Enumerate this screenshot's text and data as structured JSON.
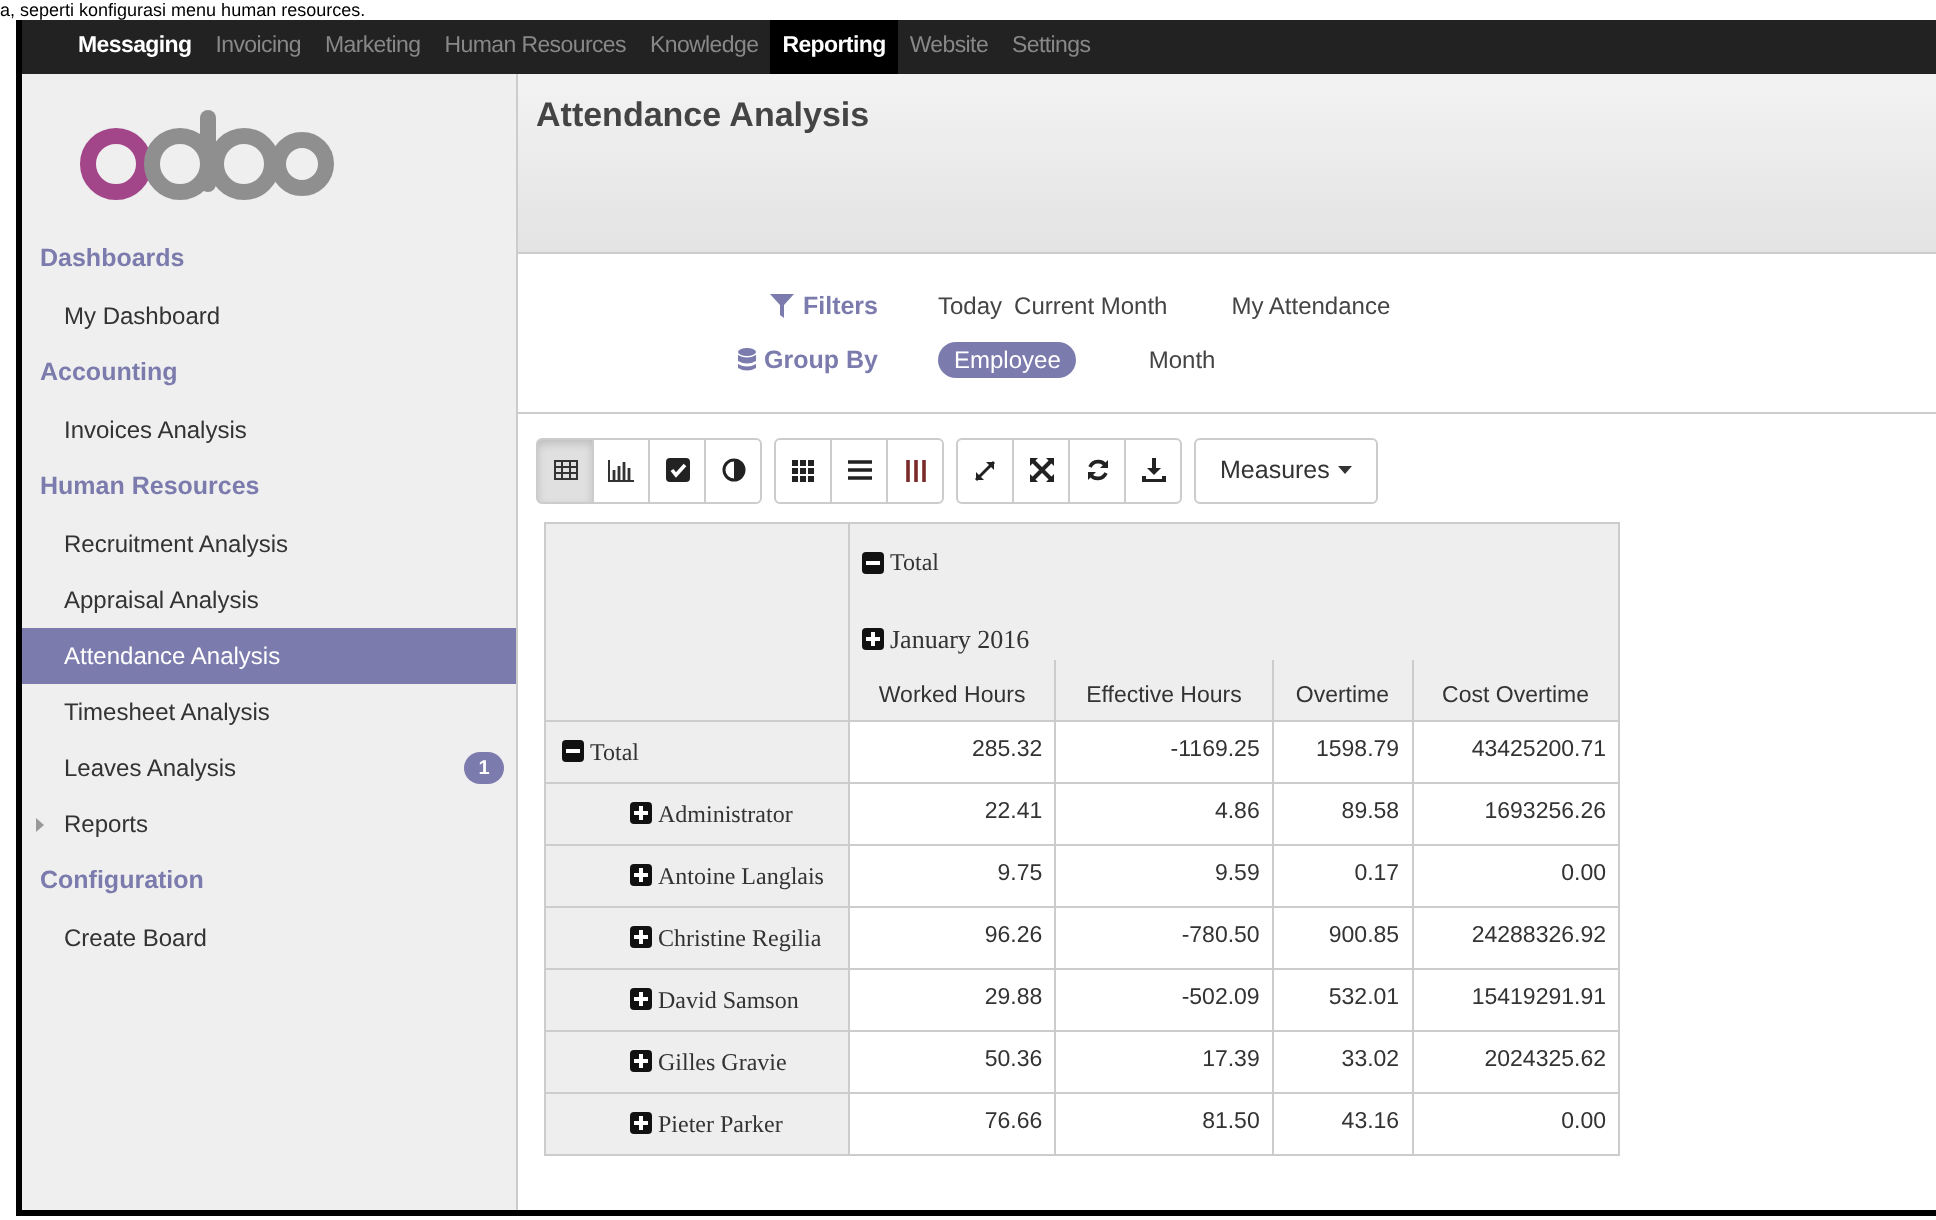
{
  "caption": "a, seperti konfigurasi menu human resources.",
  "navbar": {
    "items": [
      {
        "label": "Messaging",
        "bold": true,
        "selected": false
      },
      {
        "label": "Invoicing",
        "bold": false,
        "selected": false
      },
      {
        "label": "Marketing",
        "bold": false,
        "selected": false
      },
      {
        "label": "Human Resources",
        "bold": false,
        "selected": false
      },
      {
        "label": "Knowledge",
        "bold": false,
        "selected": false
      },
      {
        "label": "Reporting",
        "bold": true,
        "selected": true
      },
      {
        "label": "Website",
        "bold": false,
        "selected": false
      },
      {
        "label": "Settings",
        "bold": false,
        "selected": false
      }
    ]
  },
  "sidebar": {
    "sections": [
      {
        "title": "Dashboards",
        "items": [
          {
            "label": "My Dashboard",
            "selected": false
          }
        ]
      },
      {
        "title": "Accounting",
        "items": [
          {
            "label": "Invoices Analysis",
            "selected": false
          }
        ]
      },
      {
        "title": "Human Resources",
        "items": [
          {
            "label": "Recruitment Analysis",
            "selected": false
          },
          {
            "label": "Appraisal Analysis",
            "selected": false
          },
          {
            "label": "Attendance Analysis",
            "selected": true
          },
          {
            "label": "Timesheet Analysis",
            "selected": false
          },
          {
            "label": "Leaves Analysis",
            "selected": false,
            "badge": "1"
          },
          {
            "label": "Reports",
            "selected": false,
            "expandable": true
          }
        ]
      },
      {
        "title": "Configuration",
        "items": [
          {
            "label": "Create Board",
            "selected": false
          }
        ]
      }
    ]
  },
  "page_title": "Attendance Analysis",
  "filters": {
    "label": "Filters",
    "options": [
      {
        "label": "Today",
        "selected": false
      },
      {
        "label": "Current Month",
        "selected": false
      },
      {
        "label": "My Attendance",
        "selected": false
      }
    ]
  },
  "group_by": {
    "label": "Group By",
    "options": [
      {
        "label": "Employee",
        "selected": true
      },
      {
        "label": "Month",
        "selected": false
      }
    ]
  },
  "toolbar": {
    "groups": [
      [
        {
          "kind": "table",
          "selected": true
        },
        {
          "kind": "bar",
          "selected": false
        },
        {
          "kind": "check",
          "selected": false
        },
        {
          "kind": "contrast",
          "selected": false
        }
      ],
      [
        {
          "kind": "grid",
          "selected": false
        },
        {
          "kind": "rows",
          "selected": false
        },
        {
          "kind": "columns",
          "selected": false
        }
      ],
      [
        {
          "kind": "expand",
          "selected": false
        },
        {
          "kind": "collapse",
          "selected": false
        },
        {
          "kind": "refresh",
          "selected": false
        },
        {
          "kind": "download",
          "selected": false
        }
      ]
    ],
    "measures": "Measures"
  },
  "table": {
    "column_groups": [
      {
        "label": "Total",
        "expanded": true
      },
      {
        "label": "January 2016",
        "expanded": false
      }
    ],
    "columns": [
      "Worked Hours",
      "Effective Hours",
      "Overtime",
      "Cost Overtime"
    ],
    "rows": [
      {
        "label": "Total",
        "expanded": true,
        "cells": [
          "285.32",
          "-1169.25",
          "1598.79",
          "43425200.71"
        ]
      },
      {
        "label": "Administrator",
        "expanded": false,
        "cells": [
          "22.41",
          "4.86",
          "89.58",
          "1693256.26"
        ]
      },
      {
        "label": "Antoine Langlais",
        "expanded": false,
        "cells": [
          "9.75",
          "9.59",
          "0.17",
          "0.00"
        ]
      },
      {
        "label": "Christine Regilia",
        "expanded": false,
        "cells": [
          "96.26",
          "-780.50",
          "900.85",
          "24288326.92"
        ]
      },
      {
        "label": "David Samson",
        "expanded": false,
        "cells": [
          "29.88",
          "-502.09",
          "532.01",
          "15419291.91"
        ]
      },
      {
        "label": "Gilles Gravie",
        "expanded": false,
        "cells": [
          "50.36",
          "17.39",
          "33.02",
          "2024325.62"
        ]
      },
      {
        "label": "Pieter Parker",
        "expanded": false,
        "cells": [
          "76.66",
          "81.50",
          "43.16",
          "0.00"
        ]
      }
    ]
  }
}
